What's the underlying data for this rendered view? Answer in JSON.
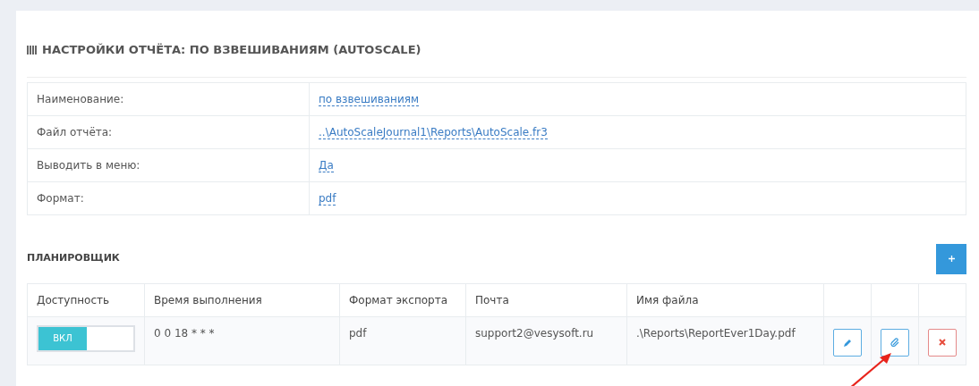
{
  "title": "НАСТРОЙКИ ОТЧЁТА: ПО ВЗВЕШИВАНИЯМ (AUTOSCALE)",
  "settings": [
    {
      "label": "Наименование:",
      "value": "по взвешиваниям"
    },
    {
      "label": "Файл отчёта:",
      "value": "..\\AutoScaleJournal1\\Reports\\AutoScale.fr3"
    },
    {
      "label": "Выводить в меню:",
      "value": "Да"
    },
    {
      "label": "Формат:",
      "value": "pdf"
    }
  ],
  "scheduler": {
    "title": "ПЛАНИРОВЩИК",
    "columns": [
      "Доступность",
      "Время выполнения",
      "Формат экспорта",
      "Почта",
      "Имя файла"
    ],
    "rows": [
      {
        "enabled": true,
        "toggle_label": "ВКЛ",
        "time": "0 0 18 * * *",
        "format": "pdf",
        "email": "support2@vesysoft.ru",
        "file": ".\\Reports\\ReportEver1Day.pdf"
      }
    ]
  },
  "annotation": {
    "kind": "arrow"
  }
}
